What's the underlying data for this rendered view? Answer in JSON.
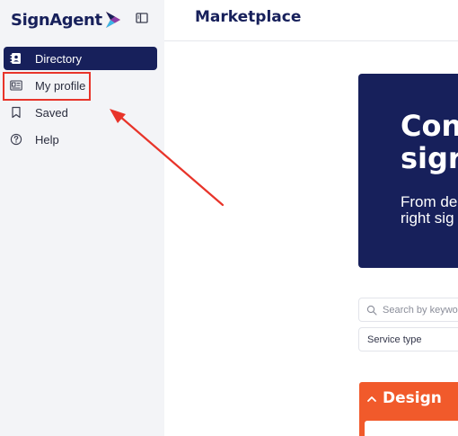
{
  "app": {
    "logo_text": "SignAgent"
  },
  "sidebar": {
    "items": [
      {
        "label": "Directory",
        "icon": "contact-book-icon",
        "active": true
      },
      {
        "label": "My profile",
        "icon": "id-card-icon",
        "active": false
      },
      {
        "label": "Saved",
        "icon": "bookmark-icon",
        "active": false
      },
      {
        "label": "Help",
        "icon": "help-circle-icon",
        "active": false
      }
    ]
  },
  "header": {
    "title": "Marketplace"
  },
  "hero": {
    "title_line1": "Con",
    "title_line2": "sigr",
    "subtitle_line1": "From de",
    "subtitle_line2": "right sig"
  },
  "filters": {
    "search_placeholder": "Search by keywor",
    "service_type_label": "Service type"
  },
  "category": {
    "title": "Design"
  },
  "colors": {
    "navy": "#17205b",
    "accent_orange": "#f15a2b",
    "annotation_red": "#e8342a",
    "sidebar_bg": "#f3f4f7"
  }
}
